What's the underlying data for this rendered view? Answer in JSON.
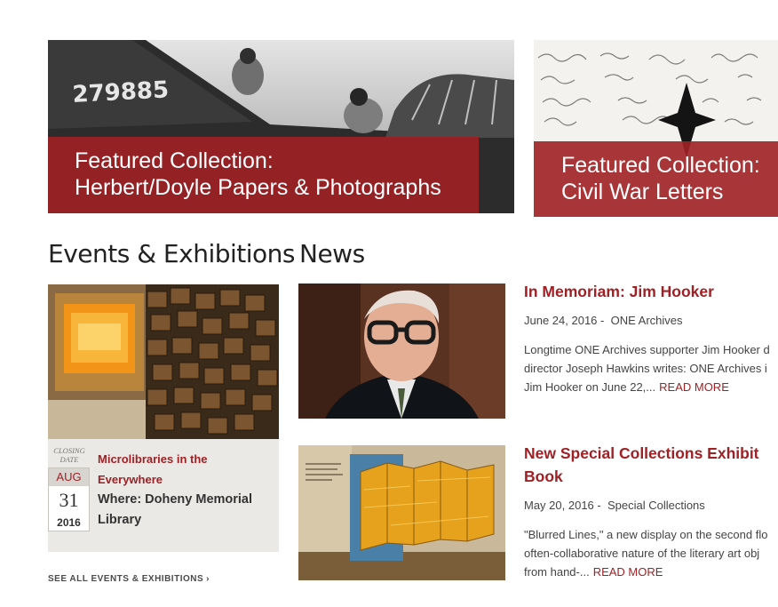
{
  "featured": [
    {
      "label_line1": "Featured Collection:",
      "label_line2": "Herbert/Doyle Papers & Photographs",
      "image_text": "279885"
    },
    {
      "label_line1": "Featured Collection:",
      "label_line2": "Civil War Letters"
    }
  ],
  "events": {
    "heading": "Events & Exhibitions",
    "card": {
      "closing_label": "CLOSING DATE",
      "month": "AUG",
      "day": "31",
      "year": "2016",
      "title": "Microlibraries in the Everywhere",
      "where": "Where: Doheny Memorial Library"
    },
    "see_all": "SEE ALL EVENTS & EXHIBITIONS"
  },
  "news": {
    "heading": "News",
    "items": [
      {
        "title": "In Memoriam: Jim Hooker",
        "date": "June 24, 2016",
        "source": "ONE Archives",
        "excerpt_line1": "Longtime ONE Archives supporter Jim Hooker d",
        "excerpt_line2": "director Joseph Hawkins writes: ONE Archives i",
        "excerpt_line3": "Jim Hooker on June 22,...",
        "read_more": "READ MORE"
      },
      {
        "title": "New Special Collections Exhibit Book",
        "date": "May 20, 2016",
        "source": "Special Collections",
        "excerpt_line1": "\"Blurred Lines,\" a new display on the second flo",
        "excerpt_line2": "often-collaborative nature of the literary art obj",
        "excerpt_line3": "from hand-...",
        "read_more": "READ MORE"
      }
    ]
  },
  "colors": {
    "brand_red": "#a02125",
    "card_background": "#ebe9e5"
  },
  "icons": {
    "see_all_chevron": "chevron-right-icon"
  }
}
